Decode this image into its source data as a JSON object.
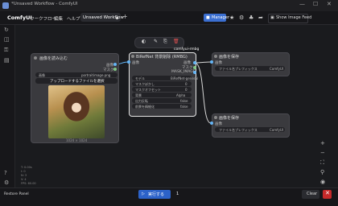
{
  "window": {
    "title": "*Unsaved Workflow - ComfyUI",
    "minimize": "—",
    "maximize": "☐",
    "close": "✕"
  },
  "menu": {
    "app_name": "ComfyUI",
    "items": [
      "ワークフロー",
      "編集",
      "ヘルプ"
    ]
  },
  "tab": {
    "label": "Unsaved Workflow",
    "add": "+"
  },
  "toolbar": {
    "manager_label": "Manager",
    "feed_label": "Show Image Feed",
    "feed_icon": "▣",
    "icons": [
      "★",
      "⚙",
      "♣",
      "➦"
    ]
  },
  "sidebar": {
    "icons": [
      "↻",
      "◫",
      "⚿",
      "▤",
      "?",
      "⚙"
    ],
    "stats": [
      "T: 0.00s",
      "I: 0",
      "N: 3",
      "V: 4",
      "FPS: 60.00"
    ]
  },
  "node_load": {
    "title": "画像を読み込む",
    "out_image": "画像",
    "out_mask": "マスク",
    "field_label": "画像",
    "field_value": "portraitimage.png",
    "upload_label": "アップロードするファイルを選択",
    "image_dims": "1024 × 1024"
  },
  "node_birefnet": {
    "title": "BiRefNet 背景削除 (RMBG)",
    "in_image": "画像",
    "out_image": "画像",
    "out_mask": "マスク",
    "out_mask_image": "MASK_IMAGE",
    "fields": [
      {
        "label": "モデル",
        "value": "BiRefNet-general"
      },
      {
        "label": "マスクぼかし",
        "value": "0"
      },
      {
        "label": "マスクオフセット",
        "value": "0"
      },
      {
        "label": "背景",
        "value": "Alpha"
      },
      {
        "label": "出力反転",
        "value": "false"
      },
      {
        "label": "前景を精細化",
        "value": "false"
      }
    ]
  },
  "node_save1": {
    "title": "画像を保存",
    "in_image": "画像",
    "prefix_label": "ファイル名プレフィックス",
    "prefix_value": "ComfyUI"
  },
  "node_save2": {
    "title": "画像を保存",
    "in_image": "画像",
    "prefix_label": "ファイル名プレフィックス",
    "prefix_value": "ComfyUI"
  },
  "canvas": {
    "hint": "comfyui-rmbg",
    "floating_icons": [
      "◐",
      "✎",
      "⎘",
      "🗑"
    ]
  },
  "right_tools": [
    "+",
    "−",
    "⛶",
    "⚲",
    "◉"
  ],
  "bottom": {
    "restore_label": "Restore Panel",
    "run_label": "実行する",
    "run_icon": "▷",
    "queue_count": "1",
    "clear_label": "Clear",
    "close": "✕"
  },
  "colors": {
    "accent": "#3b6fd1",
    "port_image": "#64b5f6",
    "port_mask": "#81c784",
    "danger": "#c62a2a"
  }
}
